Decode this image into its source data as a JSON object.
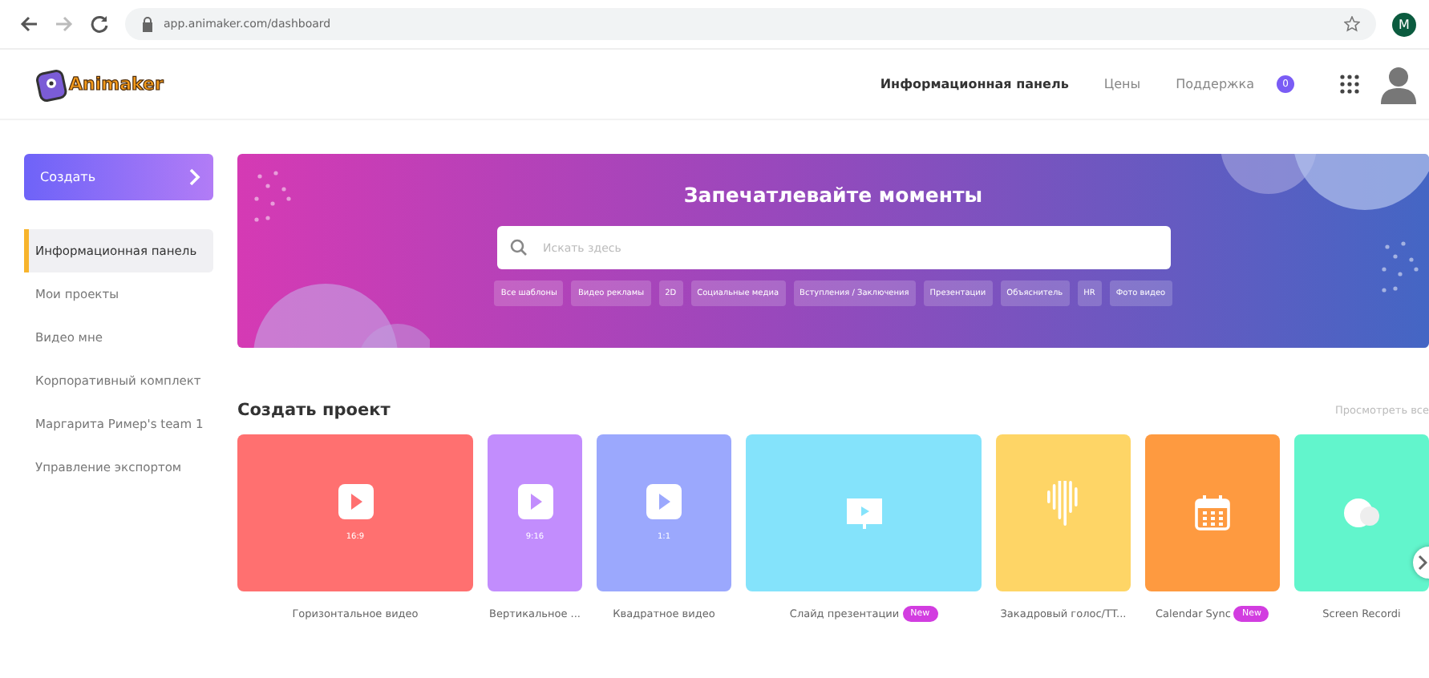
{
  "browser": {
    "url": "app.animaker.com/dashboard",
    "profile_initial": "M"
  },
  "logo": {
    "text": "Animaker"
  },
  "nav": [
    {
      "label": "Информационная панель",
      "selected": true
    },
    {
      "label": "Цены",
      "selected": false
    },
    {
      "label": "Поддержка",
      "selected": false
    }
  ],
  "notification_count": "0",
  "sidebar": {
    "create_button": "Создать",
    "items": [
      {
        "label": "Информационная панель",
        "selected": true
      },
      {
        "label": "Мои проекты",
        "selected": false
      },
      {
        "label": "Видео мне",
        "selected": false
      },
      {
        "label": "Корпоративный комплект",
        "selected": false
      },
      {
        "label": "Маргарита Ример's team 1",
        "selected": false
      },
      {
        "label": "Управление экспортом",
        "selected": false
      }
    ]
  },
  "banner": {
    "title": "Запечатлевайте моменты",
    "search": {
      "placeholder": "Искать здесь"
    },
    "tags": [
      "Все шаблоны",
      "Видео рекламы",
      "2D",
      "Социальные медиа",
      "Вступления / Заключения",
      "Презентации",
      "Объяснитель",
      "HR",
      "Фото видео"
    ]
  },
  "projects": {
    "title": "Создать проект",
    "view_all": "Просмотреть все",
    "cards": [
      {
        "kind": "video",
        "label": "Горизонтальное видео",
        "ratio": "16:9",
        "color": "#ff7070"
      },
      {
        "kind": "video",
        "label": "Вертикальное ...",
        "ratio": "9:16",
        "color": "#c28dfd"
      },
      {
        "kind": "video",
        "label": "Квадратное видео",
        "ratio": "1:1",
        "color": "#9ba8fd"
      },
      {
        "kind": "slide",
        "label": "Слайд презентации",
        "color": "#84e3fb",
        "badge": "New"
      },
      {
        "kind": "voice",
        "label": "Закадровый голос/TT...",
        "color": "#fed566"
      },
      {
        "kind": "calendar",
        "label": "Calendar Sync",
        "color": "#fe9a40",
        "badge": "New"
      },
      {
        "kind": "screen",
        "label": "Screen Recordi",
        "color": "#62f5cc"
      }
    ]
  }
}
